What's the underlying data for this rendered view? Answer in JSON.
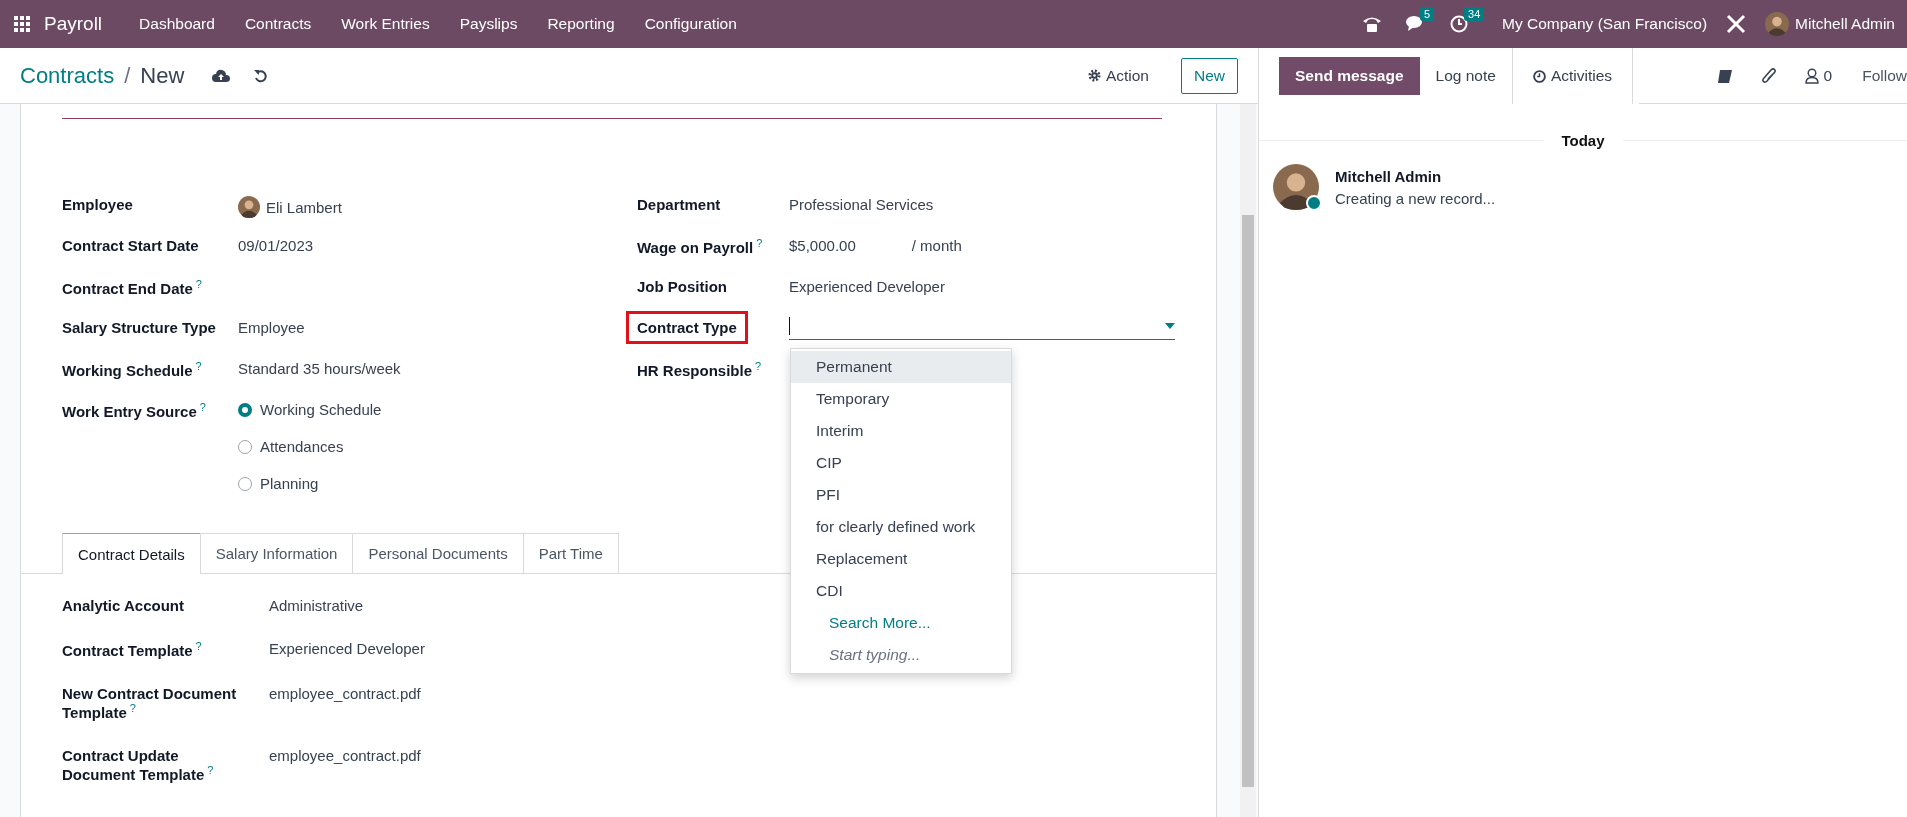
{
  "navbar": {
    "app_name": "Payroll",
    "menu": [
      "Dashboard",
      "Contracts",
      "Work Entries",
      "Payslips",
      "Reporting",
      "Configuration"
    ],
    "messages_badge": "5",
    "activities_badge": "34",
    "company": "My Company (San Francisco)",
    "user": "Mitchell Admin"
  },
  "control_bar": {
    "breadcrumb": [
      {
        "label": "Contracts",
        "kind": "link"
      },
      {
        "label": "/",
        "kind": "separator"
      },
      {
        "label": "New",
        "kind": "current"
      }
    ],
    "action_label": "Action",
    "new_label": "New"
  },
  "form": {
    "left_fields": [
      {
        "label": "Employee",
        "value": "Eli Lambert",
        "kind": "avatar"
      },
      {
        "label": "Contract Start Date",
        "value": "09/01/2023",
        "kind": "text"
      },
      {
        "label": "Contract End Date",
        "help": "?",
        "kind": "text"
      },
      {
        "label": "Salary Structure Type",
        "value": "Employee",
        "kind": "text"
      },
      {
        "label": "Working Schedule",
        "help": "?",
        "value": "Standard 35 hours/week",
        "kind": "text"
      },
      {
        "label": "Work Entry Source",
        "help": "?",
        "kind": "radio",
        "options": [
          {
            "label": "Working Schedule",
            "selected": true
          },
          {
            "label": "Attendances",
            "selected": false
          },
          {
            "label": "Planning",
            "selected": false
          }
        ]
      }
    ],
    "right_fields": [
      {
        "label": "Department",
        "value": "Professional Services",
        "kind": "text"
      },
      {
        "label": "Wage on Payroll",
        "help": "?",
        "value": "$5,000.00",
        "unit": "/ month",
        "kind": "text"
      },
      {
        "label": "Job Position",
        "value": "Experienced Developer",
        "kind": "text"
      },
      {
        "label": "Contract Type",
        "kind": "dropdown",
        "highlighted": true
      },
      {
        "label": "HR Responsible",
        "help": "?",
        "kind": "text"
      }
    ],
    "dropdown": {
      "options": [
        {
          "label": "Permanent",
          "selected": true
        },
        {
          "label": "Temporary",
          "selected": false
        },
        {
          "label": "Interim",
          "selected": false
        },
        {
          "label": "CIP",
          "selected": false
        },
        {
          "label": "PFI",
          "selected": false
        },
        {
          "label": "for clearly defined work",
          "selected": false
        },
        {
          "label": "Replacement",
          "selected": false
        },
        {
          "label": "CDI",
          "selected": false
        }
      ],
      "search_more": "Search More...",
      "hint": "Start typing..."
    },
    "tabs": [
      {
        "label": "Contract Details",
        "selected": true
      },
      {
        "label": "Salary Information",
        "selected": false
      },
      {
        "label": "Personal Documents",
        "selected": false
      },
      {
        "label": "Part Time",
        "selected": false
      }
    ],
    "tab_fields": [
      {
        "label": "Analytic Account",
        "value": "Administrative"
      },
      {
        "label": "Contract Template",
        "help": "?",
        "value": "Experienced Developer"
      },
      {
        "label": "New Contract Document Template",
        "help": "?",
        "value": "employee_contract.pdf"
      },
      {
        "label": "Contract Update Document Template",
        "help": "?",
        "value": "employee_contract.pdf"
      }
    ]
  },
  "chatter": {
    "composer": [
      {
        "label": "Send message",
        "selected": true
      },
      {
        "label": "Log note",
        "selected": false
      }
    ],
    "activities_label": "Activities",
    "followers_count": "0",
    "follow_label": "Follow",
    "date_separator": "Today",
    "messages": [
      {
        "author": "Mitchell Admin",
        "body": "Creating a new record...",
        "online": true
      }
    ]
  }
}
